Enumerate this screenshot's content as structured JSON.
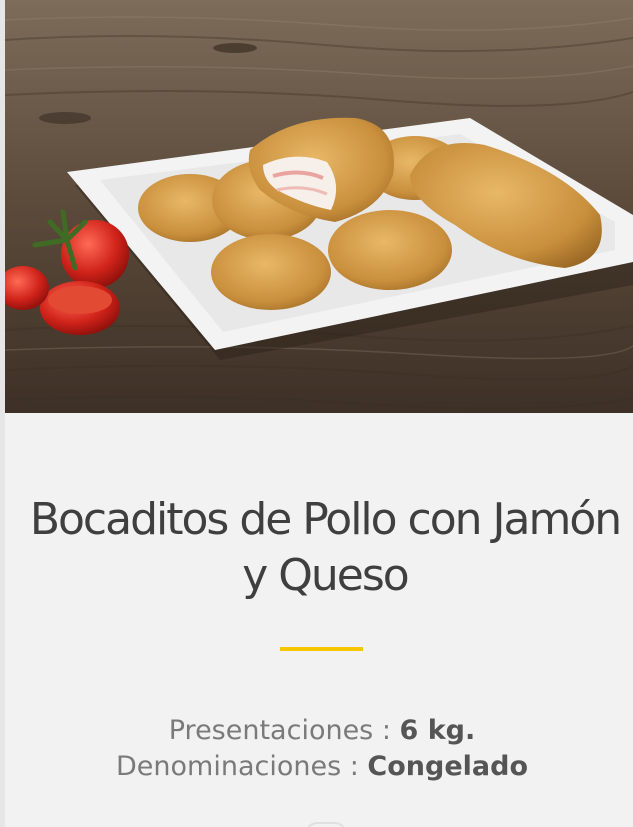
{
  "product": {
    "image_alt": "Bocaditos de Pollo con Jamón y Queso en plato",
    "title_line1": "Bocaditos de Pollo con Jamón",
    "title_line2": "y Queso",
    "accent_color": "#f6c700"
  },
  "specs": {
    "presentation_label": "Presentaciones : ",
    "presentation_value": "6 kg.",
    "denomination_label": "Denominaciones : ",
    "denomination_value": "Congelado"
  }
}
